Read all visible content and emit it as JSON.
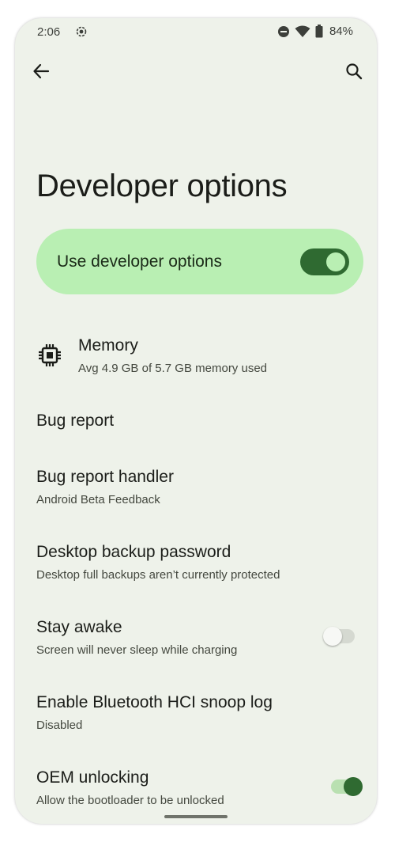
{
  "status_bar": {
    "time": "2:06",
    "battery_percent": "84%",
    "icons": [
      "screen-record-icon",
      "do-not-disturb-icon",
      "wifi-icon",
      "battery-icon"
    ]
  },
  "app_bar": {
    "back_icon": "arrow-left-icon",
    "search_icon": "search-icon"
  },
  "page": {
    "title": "Developer options"
  },
  "master_toggle": {
    "label": "Use developer options",
    "state": "on"
  },
  "settings": {
    "memory": {
      "title": "Memory",
      "subtitle": "Avg 4.9 GB of 5.7 GB memory used",
      "icon": "memory-chip-icon"
    },
    "bug_report": {
      "title": "Bug report"
    },
    "bug_report_handler": {
      "title": "Bug report handler",
      "subtitle": "Android Beta Feedback"
    },
    "desktop_backup": {
      "title": "Desktop backup password",
      "subtitle": "Desktop full backups aren’t currently protected"
    },
    "stay_awake": {
      "title": "Stay awake",
      "subtitle": "Screen will never sleep while charging",
      "state": "off"
    },
    "bt_snoop": {
      "title": "Enable Bluetooth HCI snoop log",
      "subtitle": "Disabled"
    },
    "oem_unlocking": {
      "title": "OEM unlocking",
      "subtitle": "Allow the bootloader to be unlocked",
      "state": "on"
    }
  },
  "colors": {
    "background": "#eef2ea",
    "accent_container": "#b9efb3",
    "accent": "#2f6a31",
    "text_primary": "#1b1d19",
    "text_secondary": "#44483f"
  }
}
